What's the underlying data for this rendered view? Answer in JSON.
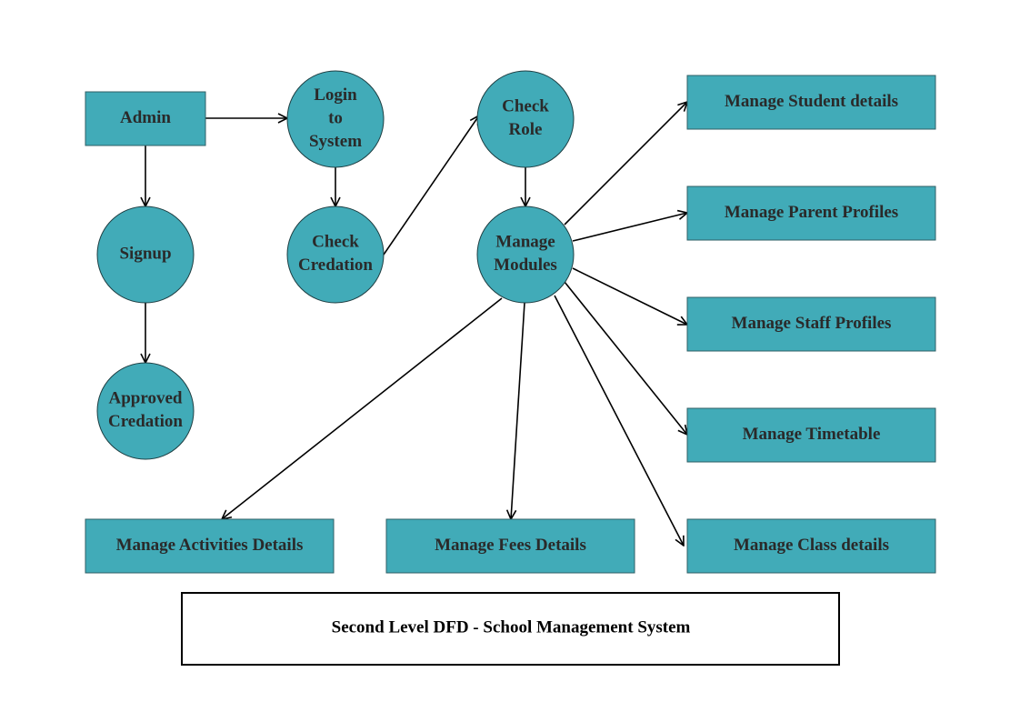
{
  "diagram": {
    "title": "Second Level DFD - School Management System",
    "colors": {
      "node_fill": "#41abb8",
      "text": "#2a2a2a",
      "edge": "#000000"
    },
    "nodes": [
      {
        "id": "admin",
        "type": "entity",
        "lines": [
          "Admin"
        ]
      },
      {
        "id": "login",
        "type": "process",
        "lines": [
          "Login",
          "to",
          "System"
        ]
      },
      {
        "id": "signup",
        "type": "process",
        "lines": [
          "Signup"
        ]
      },
      {
        "id": "approved",
        "type": "process",
        "lines": [
          "Approved",
          "Credation"
        ]
      },
      {
        "id": "checkcred",
        "type": "process",
        "lines": [
          "Check",
          "Credation"
        ]
      },
      {
        "id": "checkrole",
        "type": "process",
        "lines": [
          "Check",
          "Role"
        ]
      },
      {
        "id": "modules",
        "type": "process",
        "lines": [
          "Manage",
          "Modules"
        ]
      },
      {
        "id": "student",
        "type": "entity",
        "lines": [
          "Manage Student details"
        ]
      },
      {
        "id": "parent",
        "type": "entity",
        "lines": [
          "Manage Parent Profiles"
        ]
      },
      {
        "id": "staff",
        "type": "entity",
        "lines": [
          "Manage Staff Profiles"
        ]
      },
      {
        "id": "timetable",
        "type": "entity",
        "lines": [
          "Manage Timetable"
        ]
      },
      {
        "id": "class",
        "type": "entity",
        "lines": [
          "Manage Class details"
        ]
      },
      {
        "id": "fees",
        "type": "entity",
        "lines": [
          "Manage Fees Details"
        ]
      },
      {
        "id": "activities",
        "type": "entity",
        "lines": [
          "Manage Activities Details"
        ]
      }
    ],
    "edges": [
      {
        "from": "admin",
        "to": "login"
      },
      {
        "from": "admin",
        "to": "signup"
      },
      {
        "from": "signup",
        "to": "approved"
      },
      {
        "from": "login",
        "to": "checkcred"
      },
      {
        "from": "checkcred",
        "to": "checkrole"
      },
      {
        "from": "checkrole",
        "to": "modules"
      },
      {
        "from": "modules",
        "to": "student"
      },
      {
        "from": "modules",
        "to": "parent"
      },
      {
        "from": "modules",
        "to": "staff"
      },
      {
        "from": "modules",
        "to": "timetable"
      },
      {
        "from": "modules",
        "to": "class"
      },
      {
        "from": "modules",
        "to": "fees"
      },
      {
        "from": "modules",
        "to": "activities"
      }
    ]
  }
}
